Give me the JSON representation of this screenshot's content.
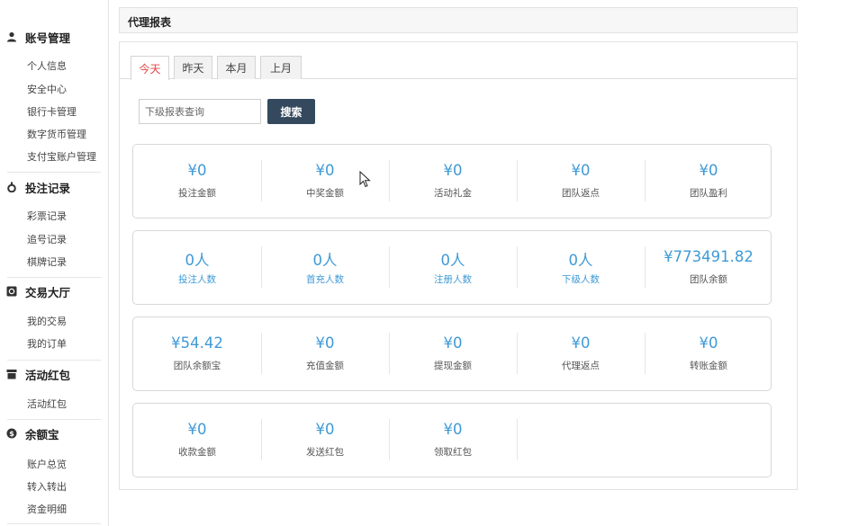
{
  "sidebar": {
    "groups": [
      {
        "title": "账号管理",
        "icon": "user-icon",
        "items": [
          "个人信息",
          "安全中心",
          "银行卡管理",
          "数字货币管理",
          "支付宝账户管理"
        ]
      },
      {
        "title": "投注记录",
        "icon": "bet-icon",
        "items": [
          "彩票记录",
          "追号记录",
          "棋牌记录"
        ]
      },
      {
        "title": "交易大厅",
        "icon": "trade-icon",
        "items": [
          "我的交易",
          "我的订单"
        ]
      },
      {
        "title": "活动红包",
        "icon": "redpacket-icon",
        "items": [
          "活动红包"
        ]
      },
      {
        "title": "余额宝",
        "icon": "coin-icon",
        "items": [
          "账户总览",
          "转入转出",
          "资金明细"
        ]
      }
    ]
  },
  "page": {
    "title": "代理报表"
  },
  "tabs": [
    {
      "label": "今天",
      "active": true
    },
    {
      "label": "昨天",
      "active": false
    },
    {
      "label": "本月",
      "active": false
    },
    {
      "label": "上月",
      "active": false
    }
  ],
  "search": {
    "placeholder": "下级报表查询",
    "button_label": "搜索"
  },
  "stats": [
    [
      {
        "value": "¥0",
        "label": "投注金额"
      },
      {
        "value": "¥0",
        "label": "中奖金额"
      },
      {
        "value": "¥0",
        "label": "活动礼金"
      },
      {
        "value": "¥0",
        "label": "团队返点"
      },
      {
        "value": "¥0",
        "label": "团队盈利"
      }
    ],
    [
      {
        "value": "0人",
        "label": "投注人数",
        "link": true
      },
      {
        "value": "0人",
        "label": "首充人数",
        "link": true
      },
      {
        "value": "0人",
        "label": "注册人数",
        "link": true
      },
      {
        "value": "0人",
        "label": "下级人数",
        "link": true
      },
      {
        "value": "¥773491.82",
        "label": "团队余额"
      }
    ],
    [
      {
        "value": "¥54.42",
        "label": "团队余额宝"
      },
      {
        "value": "¥0",
        "label": "充值金额"
      },
      {
        "value": "¥0",
        "label": "提现金额"
      },
      {
        "value": "¥0",
        "label": "代理返点"
      },
      {
        "value": "¥0",
        "label": "转账金额"
      }
    ],
    [
      {
        "value": "¥0",
        "label": "收款金额"
      },
      {
        "value": "¥0",
        "label": "发送红包"
      },
      {
        "value": "¥0",
        "label": "领取红包"
      }
    ]
  ],
  "colors": {
    "accent": "#3f9ad6",
    "active_tab": "#e64343",
    "button": "#34495e"
  }
}
